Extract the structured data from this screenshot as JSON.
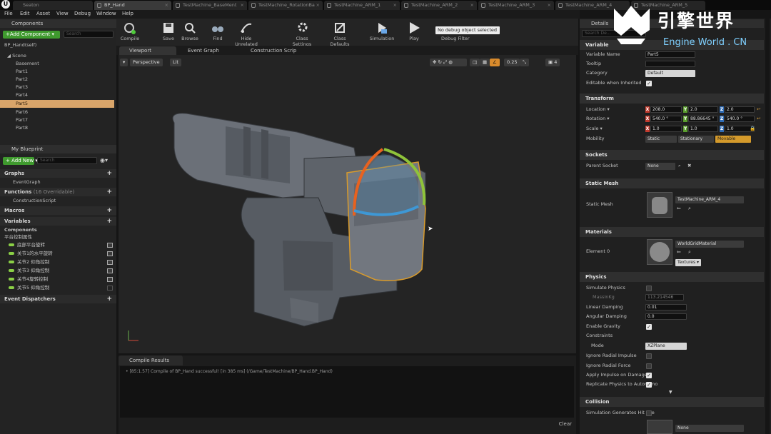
{
  "tabs": [
    {
      "label": "Seaton"
    },
    {
      "label": "BP_Hand"
    },
    {
      "label": "TestMachine_BaseMent"
    },
    {
      "label": "TestMachine_RotationBa"
    },
    {
      "label": "TestMachine_ARM_1"
    },
    {
      "label": "TestMachine_ARM_2"
    },
    {
      "label": "TestMachine_ARM_3"
    },
    {
      "label": "TestMachine_ARM_4"
    },
    {
      "label": "TestMachine_ARM_5"
    }
  ],
  "menu": [
    "File",
    "Edit",
    "Asset",
    "View",
    "Debug",
    "Window",
    "Help"
  ],
  "components": {
    "title": "Components",
    "add_label": "+Add Component ▾",
    "search_placeholder": "Search",
    "self_label": "BP_Hand(self)",
    "scene_label": "Scene",
    "items": [
      "Basement",
      "Part1",
      "Part2",
      "Part3",
      "Part4",
      "Part5",
      "Part6",
      "Part7",
      "Part8"
    ]
  },
  "blueprint": {
    "title": "My Blueprint",
    "add_label": "+ Add New ▾",
    "search_placeholder": "Search",
    "graphs": "Graphs",
    "event_graph": "EventGraph",
    "functions": "Functions",
    "functions_count": "(16 Overridable)",
    "construction": "ConstructionScript",
    "macros": "Macros",
    "variables": "Variables",
    "comp_group": "Components",
    "var_group": "平台控制属性",
    "vars": [
      "底部平台旋转",
      "关节1的水平旋转",
      "关节2 仰角控制",
      "关节3 仰角控制",
      "关节4旋转控制",
      "关节5 仰角控制"
    ],
    "dispatchers": "Event Dispatchers"
  },
  "toolbar": {
    "compile": "Compile",
    "save": "Save",
    "browse": "Browse",
    "find": "Find",
    "hide_unrelated": "Hide Unrelated",
    "class_settings": "Class Settings",
    "class_defaults": "Class Defaults",
    "simulation": "Simulation",
    "play": "Play",
    "debug_select": "No debug object selected ▾",
    "debug_filter": "Debug Filter"
  },
  "editor_tabs": [
    "Viewport",
    "Event Graph",
    "Construction Scrip"
  ],
  "viewport": {
    "perspective": "Perspective",
    "lit": "Lit",
    "snap_value": "0.25",
    "cam_speed": "4"
  },
  "results": {
    "title": "Compile Results",
    "line": "• [85:1.57] Compile of BP_Hand successful! [in 385 ms] (/Game/TestMachine/BP_Hand.BP_Hand)",
    "clear": "Clear"
  },
  "details": {
    "title": "Details",
    "search_placeholder": "Search De...",
    "variable_section": "Variable",
    "variable_name_label": "Variable Name",
    "variable_name": "Part5",
    "tooltip_label": "Tooltip",
    "category_label": "Category",
    "category": "Default",
    "editable_label": "Editable when Inherited",
    "transform_section": "Transform",
    "location_label": "Location ▾",
    "location": [
      "208.0",
      "2.0",
      "2.0"
    ],
    "rotation_label": "Rotation ▾",
    "rotation": [
      "540.0 °",
      "88.86645 °",
      "540.0 °"
    ],
    "scale_label": "Scale ▾",
    "scale": [
      "1.0",
      "1.0",
      "1.0"
    ],
    "mobility_label": "Mobility",
    "mobility": [
      "Static",
      "Stationary",
      "Movable"
    ],
    "sockets_section": "Sockets",
    "parent_socket_label": "Parent Socket",
    "parent_socket": "None",
    "static_mesh_section": "Static Mesh",
    "static_mesh_label": "Static Mesh",
    "static_mesh": "TestMachine_ARM_4",
    "materials_section": "Materials",
    "element0_label": "Element 0",
    "material": "WorldGridMaterial",
    "textures": "Textures ▾",
    "physics_section": "Physics",
    "simulate_label": "Simulate Physics",
    "mass_label": "MassInKg",
    "mass": "113.214546",
    "linear_damping_label": "Linear Damping",
    "linear_damping": "0.01",
    "angular_damping_label": "Angular Damping",
    "angular_damping": "0.0",
    "gravity_label": "Enable Gravity",
    "constraints_label": "Constraints",
    "mode_label": "Mode",
    "mode": "XZPlane",
    "ignore_impulse_label": "Ignore Radial Impulse",
    "ignore_force_label": "Ignore Radial Force",
    "apply_impulse_label": "Apply Impulse on Damage",
    "replicate_label": "Replicate Physics to Autonomo",
    "collision_section": "Collision",
    "sim_gen_label": "Simulation Generates Hit Eve",
    "collision_none": "None"
  },
  "watermark": {
    "title": "引擎世界",
    "subtitle": "Engine World . CN"
  }
}
